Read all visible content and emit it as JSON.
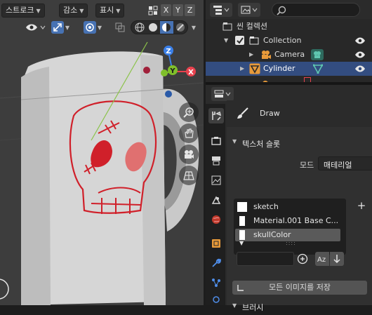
{
  "viewport": {
    "header": {
      "mode_menu": "스트로크",
      "falloff_menu": "감소",
      "display_menu": "표시",
      "axes": [
        "X",
        "Y",
        "Z"
      ]
    },
    "gizmo_axes": [
      "Z",
      "Y",
      "X"
    ]
  },
  "outliner": {
    "search_placeholder": "",
    "rows": [
      {
        "label": "씬 컬렉션"
      },
      {
        "label": "Collection"
      },
      {
        "label": "Camera"
      },
      {
        "label": "Cylinder"
      }
    ]
  },
  "properties": {
    "header_title": "Draw",
    "texture_slots_panel": "텍스처 슬롯",
    "mode_label": "모드",
    "mode_value": "매테리얼",
    "slots": [
      {
        "label": "sketch"
      },
      {
        "label": "Material.001 Base C..."
      },
      {
        "label": "skullColor"
      }
    ],
    "save_all_images": "모든 이미지를 저장",
    "brush_panel": "브러시"
  },
  "colors": {
    "selection_blue": "#334d80",
    "mug_red": "#d0202a",
    "gizmo_x": "#e8424e",
    "gizmo_y": "#7fbf2a",
    "gizmo_z": "#3a7fe8"
  }
}
